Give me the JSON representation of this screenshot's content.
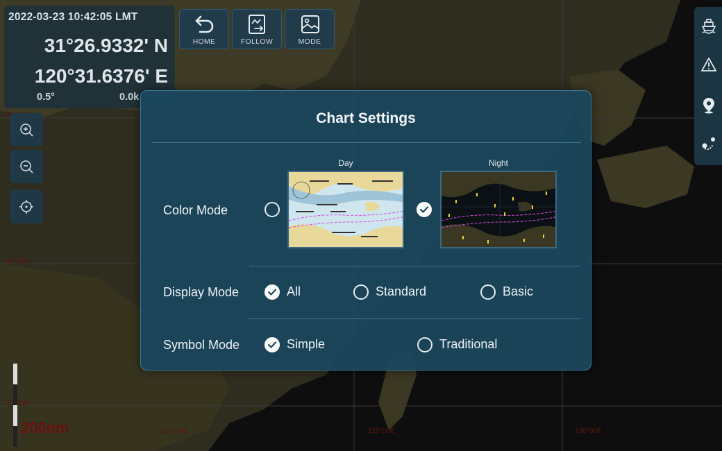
{
  "status": {
    "datetime": "2022-03-23 10:42:05 LMT",
    "latitude": "31°26.9332' N",
    "longitude": "120°31.6376' E",
    "heading": "0.5°",
    "speed": "0.0k"
  },
  "toolbar": {
    "home_label": "HOME",
    "follow_label": "FOLLOW",
    "mode_label": "MODE"
  },
  "map": {
    "scale": "200nm",
    "grid_labels": [
      "120°00E",
      "125°00E",
      "130°00E",
      "35°00N",
      "30°00N",
      "25°00N"
    ]
  },
  "dialog": {
    "title": "Chart Settings",
    "color_mode": {
      "label": "Color Mode",
      "options": [
        {
          "label": "Day",
          "selected": false
        },
        {
          "label": "Night",
          "selected": true
        }
      ]
    },
    "display_mode": {
      "label": "Display Mode",
      "options": [
        {
          "label": "All",
          "selected": true
        },
        {
          "label": "Standard",
          "selected": false
        },
        {
          "label": "Basic",
          "selected": false
        }
      ]
    },
    "symbol_mode": {
      "label": "Symbol Mode",
      "options": [
        {
          "label": "Simple",
          "selected": true
        },
        {
          "label": "Traditional",
          "selected": false
        }
      ]
    }
  },
  "colors": {
    "dialog_bg": "#1b465c",
    "dialog_border": "#3e7a99",
    "land": "#3d3a26",
    "sea": "#0e0e0e",
    "day_sea": "#cfe6ee",
    "night_sea": "#0b1014",
    "route": "#d24fd9",
    "accent_check": "#ffffff"
  },
  "icons": {
    "home": "undo-arrow-icon",
    "follow": "follow-image-icon",
    "mode": "picture-icon",
    "zoom_in": "zoom-in-icon",
    "zoom_out": "zoom-out-icon",
    "locate": "crosshair-icon",
    "ship": "ship-icon",
    "alert": "warning-icon",
    "waypoint": "map-pin-icon",
    "route": "route-icon"
  }
}
